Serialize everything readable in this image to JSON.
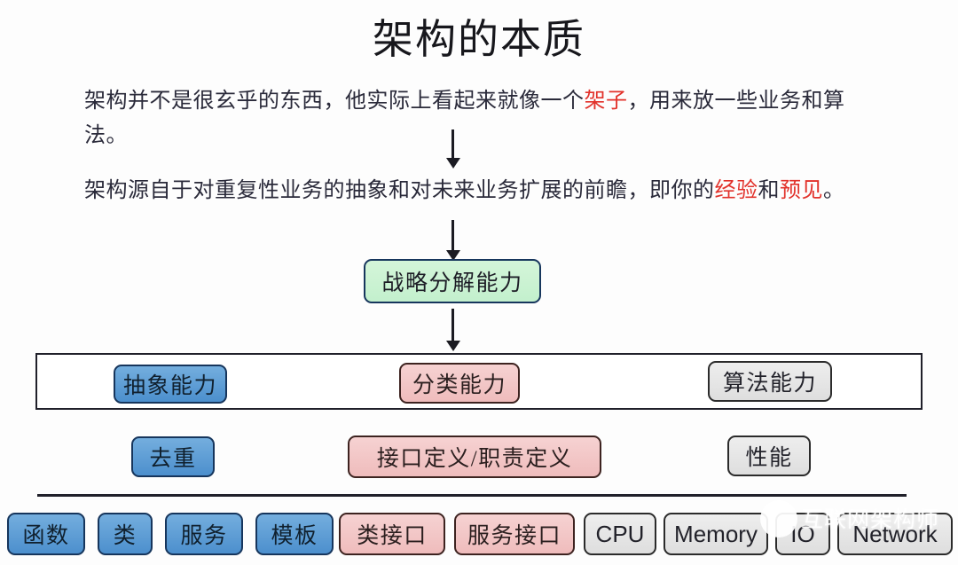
{
  "slide": {
    "title": "架构的本质",
    "paragraphs": [
      {
        "id": "para1",
        "segments": [
          {
            "text": "架构并不是很玄乎的东西，他实际上看起来就像一个",
            "highlight": false
          },
          {
            "text": "架子",
            "highlight": true
          },
          {
            "text": "，用来放一些业务和算法。",
            "highlight": false
          }
        ]
      },
      {
        "id": "para2",
        "segments": [
          {
            "text": "架构源自于对重复性业务的抽象和对未来业务扩展的前瞻，即你的",
            "highlight": false
          },
          {
            "text": "经验",
            "highlight": true
          },
          {
            "text": "和",
            "highlight": false
          },
          {
            "text": "预见",
            "highlight": true
          },
          {
            "text": "。",
            "highlight": false
          }
        ]
      }
    ],
    "strategy_node": "战略分解能力",
    "capability_band": {
      "items": [
        "抽象能力",
        "分类能力",
        "算法能力"
      ]
    },
    "detail_row": {
      "items": [
        "去重",
        "接口定义/职责定义",
        "性能"
      ]
    },
    "implementation_row": {
      "items": [
        "函数",
        "类",
        "服务",
        "模板",
        "类接口",
        "服务接口",
        "CPU",
        "Memory",
        "IO",
        "Network"
      ]
    },
    "watermark": {
      "text": "互联网架构师",
      "logo": "wechat-avatar-logo"
    },
    "colors": {
      "highlight_red": "#e2322b",
      "green_fill": "#c8f2d1",
      "blue_fill": "#4c8fcd",
      "pink_fill": "#efbcbc",
      "gray_fill": "#e4e4e4",
      "border_navy": "#17365d",
      "text_dark": "#1d1d26"
    }
  }
}
